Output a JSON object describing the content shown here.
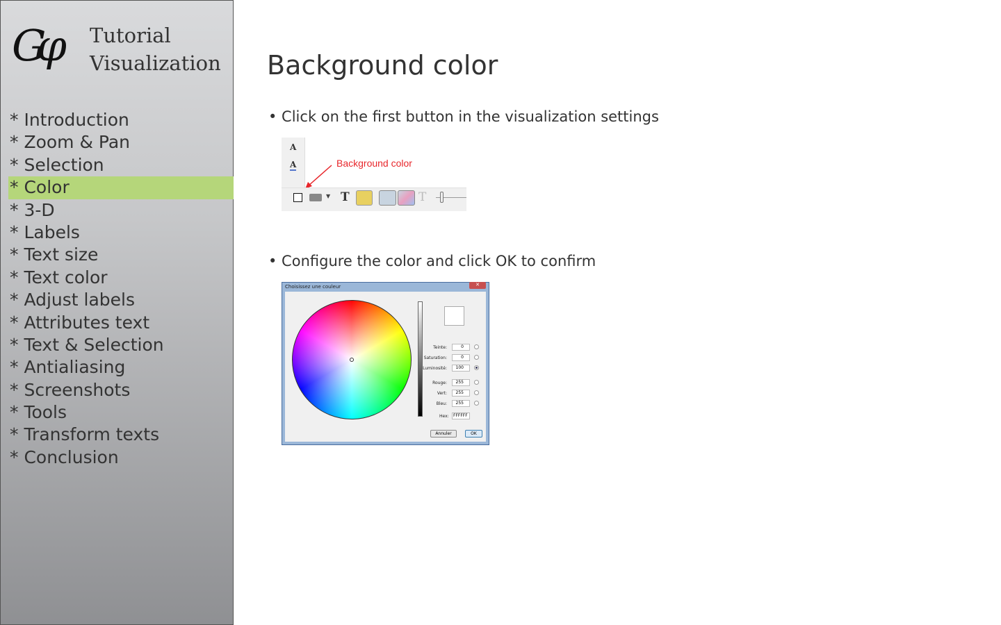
{
  "sidebar": {
    "logo_text": "Gφ",
    "brand_line1": "Tutorial",
    "brand_line2": "Visualization",
    "items": [
      {
        "label": "* Introduction"
      },
      {
        "label": "* Zoom & Pan"
      },
      {
        "label": "* Selection"
      },
      {
        "label": "* Color"
      },
      {
        "label": "* 3-D"
      },
      {
        "label": "* Labels"
      },
      {
        "label": "* Text size"
      },
      {
        "label": "* Text color"
      },
      {
        "label": "* Adjust labels"
      },
      {
        "label": "* Attributes text"
      },
      {
        "label": "* Text & Selection"
      },
      {
        "label": "* Antialiasing"
      },
      {
        "label": "* Screenshots"
      },
      {
        "label": "* Tools"
      },
      {
        "label": "* Transform texts"
      },
      {
        "label": "* Conclusion"
      }
    ],
    "active_index": 3,
    "active_color": "#b5d67a"
  },
  "main": {
    "title": "Background color",
    "step1": "• Click on the first button in the visualization settings",
    "step2": "• Configure the color and click OK to confirm",
    "toolbar_shot": {
      "annotation": "Background color",
      "annotation_color": "#e8262b"
    },
    "dialog_shot": {
      "title": "Choisissez une couleur",
      "fields": [
        {
          "label": "Teinte:",
          "value": "0"
        },
        {
          "label": "Saturation:",
          "value": "0"
        },
        {
          "label": "Luminosité:",
          "value": "100"
        },
        {
          "label": "Rouge:",
          "value": "255"
        },
        {
          "label": "Vert:",
          "value": "255"
        },
        {
          "label": "Bleu:",
          "value": "255"
        }
      ],
      "hex_label": "Hex:",
      "hex_value": "FFFFFF",
      "cancel": "Annuler",
      "ok": "OK"
    }
  }
}
